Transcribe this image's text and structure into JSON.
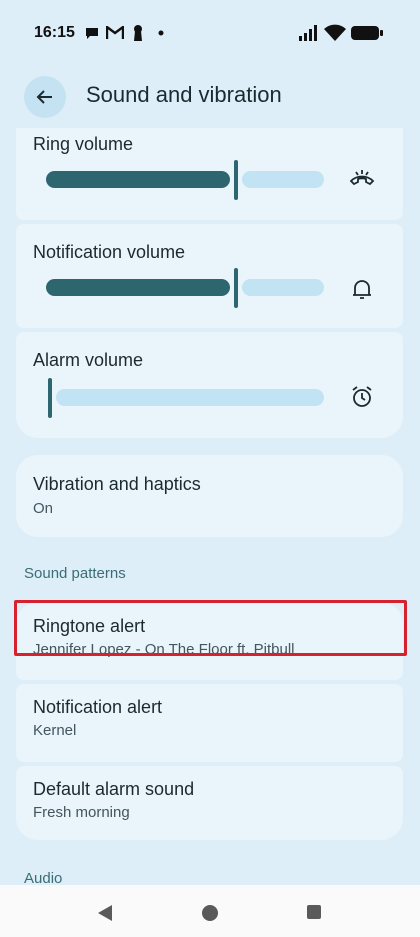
{
  "status_bar": {
    "time": "16:15"
  },
  "header": {
    "title": "Sound and vibration"
  },
  "volume": {
    "ring": {
      "label": "Ring volume",
      "level": 0.69
    },
    "notification": {
      "label": "Notification volume",
      "level": 0.69
    },
    "alarm": {
      "label": "Alarm volume",
      "level": 0.0
    }
  },
  "vibration": {
    "title": "Vibration and haptics",
    "value": "On"
  },
  "sound_patterns": {
    "header": "Sound patterns",
    "ringtone": {
      "title": "Ringtone alert",
      "value": "Jennifer Lopez - On The Floor ft. Pitbull"
    },
    "notification": {
      "title": "Notification alert",
      "value": "Kernel"
    },
    "alarm": {
      "title": "Default alarm sound",
      "value": "Fresh morning"
    }
  },
  "audio": {
    "header": "Audio"
  },
  "colors": {
    "accent": "#2e6670",
    "track": "#c2e3f4",
    "card": "#eaf5fb",
    "highlight": "#d6222f"
  },
  "icons": [
    "back-arrow-icon",
    "phone-hangup-icon",
    "bell-icon",
    "alarm-clock-icon",
    "wifi-icon",
    "battery-icon"
  ]
}
